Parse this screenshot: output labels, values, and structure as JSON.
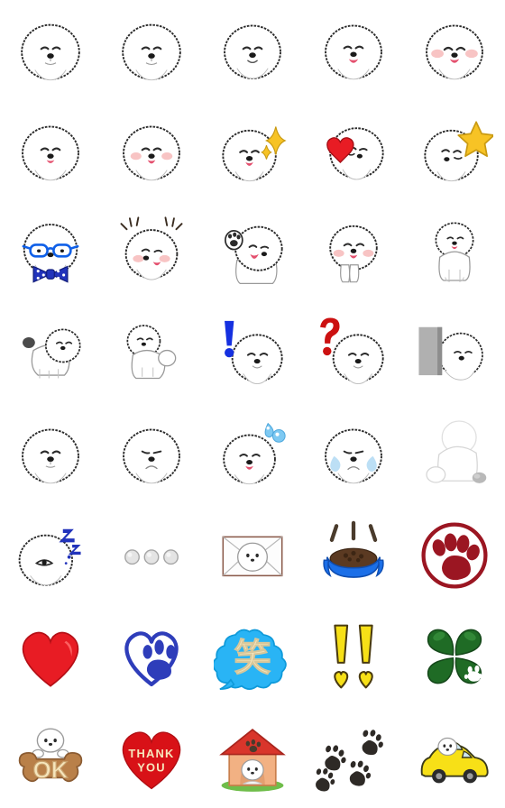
{
  "sheet": {
    "title": "Bichon Frise Emoji Sticker Set",
    "background_color": "#ffffff",
    "columns": 5,
    "rows": 8,
    "cell_size_px": 112,
    "total_stickers": 40
  },
  "palette": {
    "fur_white": "#ffffff",
    "fur_shade": "#f2f2f2",
    "outline_dark": "#2b2b2b",
    "nose_black": "#1a1a1a",
    "tongue_pink": "#e4506e",
    "blush_pink": "#f8c4c4",
    "heart_red": "#e81c24",
    "heart_red_dark": "#c4141b",
    "star_yellow": "#f7c325",
    "star_yellow_dark": "#e0a511",
    "royal_blue": "#2233bb",
    "bright_blue": "#1060e8",
    "sky_blue": "#3ab4f2",
    "cloud_blue": "#29b4f5",
    "cream": "#f6e6bd",
    "clover_green": "#1f6b25",
    "clover_green_light": "#2f8a34",
    "stamp_red": "#9b1622",
    "bone_brown": "#b98049",
    "bone_brown_light": "#caa077",
    "house_peach": "#f2b183",
    "house_roof_red": "#d9352b",
    "grass_green": "#6fbd4a",
    "car_yellow": "#f7e017",
    "tear_blue": "#bcdff5",
    "dot_gray": "#d4d4d4",
    "wall_gray": "#a8a8a8",
    "paw_black": "#2e2a26"
  },
  "stickers": [
    {
      "id": 1,
      "row": 1,
      "col": 1,
      "name": "dog-face-neutral",
      "label": "Bichon face, calm neutral expression",
      "type": "face"
    },
    {
      "id": 2,
      "row": 1,
      "col": 2,
      "name": "dog-face-neutral-2",
      "label": "Bichon face, calm neutral expression",
      "type": "face"
    },
    {
      "id": 3,
      "row": 1,
      "col": 3,
      "name": "dog-face-smiling",
      "label": "Bichon face, small smile",
      "type": "face"
    },
    {
      "id": 4,
      "row": 1,
      "col": 4,
      "name": "dog-face-tongue-out",
      "label": "Bichon face, tongue out",
      "type": "face"
    },
    {
      "id": 5,
      "row": 1,
      "col": 5,
      "name": "dog-face-blush-happy",
      "label": "Bichon face, blushing and happy",
      "type": "face"
    },
    {
      "id": 6,
      "row": 2,
      "col": 1,
      "name": "dog-face-tongue-small",
      "label": "Bichon face, little tongue",
      "type": "face"
    },
    {
      "id": 7,
      "row": 2,
      "col": 2,
      "name": "dog-face-blush-tongue",
      "label": "Bichon face, blushing with tongue",
      "type": "face"
    },
    {
      "id": 8,
      "row": 2,
      "col": 3,
      "name": "dog-face-sparkle",
      "label": "Bichon face with yellow sparkles",
      "type": "face-accessory"
    },
    {
      "id": 9,
      "row": 2,
      "col": 4,
      "name": "dog-face-red-heart",
      "label": "Bichon face with red heart",
      "type": "face-accessory"
    },
    {
      "id": 10,
      "row": 2,
      "col": 5,
      "name": "dog-face-star",
      "label": "Bichon face with yellow star",
      "type": "face-accessory"
    },
    {
      "id": 11,
      "row": 3,
      "col": 1,
      "name": "dog-glasses-bowtie",
      "label": "Bichon with blue glasses and polka-dot bow tie",
      "type": "face-accessory"
    },
    {
      "id": 12,
      "row": 3,
      "col": 2,
      "name": "dog-face-excited",
      "label": "Bichon face, excited with motion lines",
      "type": "face"
    },
    {
      "id": 13,
      "row": 3,
      "col": 3,
      "name": "dog-waving-paw",
      "label": "Bichon waving a paw, tongue out",
      "type": "body"
    },
    {
      "id": 14,
      "row": 3,
      "col": 4,
      "name": "dog-standing-happy",
      "label": "Bichon standing, blushing and happy",
      "type": "body"
    },
    {
      "id": 15,
      "row": 3,
      "col": 5,
      "name": "dog-sitting-front",
      "label": "Bichon sitting, facing front",
      "type": "body"
    },
    {
      "id": 16,
      "row": 4,
      "col": 1,
      "name": "dog-walking",
      "label": "Bichon walking, tail up",
      "type": "body"
    },
    {
      "id": 17,
      "row": 4,
      "col": 2,
      "name": "dog-sitting-side",
      "label": "Bichon sitting, side view",
      "type": "body"
    },
    {
      "id": 18,
      "row": 4,
      "col": 3,
      "name": "dog-exclamation-blue",
      "label": "Bichon with blue exclamation mark",
      "type": "face-accessory"
    },
    {
      "id": 19,
      "row": 4,
      "col": 4,
      "name": "dog-question-red",
      "label": "Bichon with red question mark",
      "type": "face-accessory"
    },
    {
      "id": 20,
      "row": 4,
      "col": 5,
      "name": "dog-peeking-wall",
      "label": "Bichon peeking from behind a gray wall",
      "type": "scene"
    },
    {
      "id": 21,
      "row": 5,
      "col": 1,
      "name": "dog-face-plain",
      "label": "Bichon face, plain expression",
      "type": "face"
    },
    {
      "id": 22,
      "row": 5,
      "col": 2,
      "name": "dog-face-sad",
      "label": "Bichon face, sad frown",
      "type": "face"
    },
    {
      "id": 23,
      "row": 5,
      "col": 3,
      "name": "dog-face-sweatdrop",
      "label": "Bichon face with blue sweat drops",
      "type": "face-accessory"
    },
    {
      "id": 24,
      "row": 5,
      "col": 4,
      "name": "dog-face-crying",
      "label": "Bichon face crying with tears",
      "type": "face"
    },
    {
      "id": 25,
      "row": 5,
      "col": 5,
      "name": "dog-back-sulking",
      "label": "Bichon seen from behind, sulking",
      "type": "body"
    },
    {
      "id": 26,
      "row": 6,
      "col": 1,
      "name": "dog-sleeping-zzz",
      "label": "Bichon sleeping with blue Z Z Z",
      "type": "face-accessory"
    },
    {
      "id": 27,
      "row": 6,
      "col": 2,
      "name": "loading-dots",
      "label": "Three gray loading dots",
      "type": "object"
    },
    {
      "id": 28,
      "row": 6,
      "col": 3,
      "name": "envelope-dog",
      "label": "White envelope with dog face",
      "type": "object"
    },
    {
      "id": 29,
      "row": 6,
      "col": 4,
      "name": "food-bowl",
      "label": "Blue dog food bowl with kibble",
      "type": "object"
    },
    {
      "id": 30,
      "row": 6,
      "col": 5,
      "name": "paw-stamp-red",
      "label": "Dark red paw print stamp in a circle",
      "type": "object"
    },
    {
      "id": 31,
      "row": 7,
      "col": 1,
      "name": "heart-red",
      "label": "Red heart",
      "type": "object"
    },
    {
      "id": 32,
      "row": 7,
      "col": 2,
      "name": "heart-paw-blue",
      "label": "Blue heart outline with paw print",
      "type": "object"
    },
    {
      "id": 33,
      "row": 7,
      "col": 3,
      "name": "speech-bubble-warai",
      "label": "Blue cloud speech bubble",
      "text": "笑",
      "type": "text-object"
    },
    {
      "id": 34,
      "row": 7,
      "col": 4,
      "name": "double-exclamation-yellow",
      "label": "Two yellow exclamation marks with heart dots",
      "text": "!!",
      "type": "text-object"
    },
    {
      "id": 35,
      "row": 7,
      "col": 5,
      "name": "four-leaf-clover",
      "label": "Green four-leaf clover with white paw",
      "type": "object"
    },
    {
      "id": 36,
      "row": 8,
      "col": 1,
      "name": "ok-bone",
      "label": "Brown bone with dog peeking over",
      "text": "OK",
      "type": "text-object"
    },
    {
      "id": 37,
      "row": 8,
      "col": 2,
      "name": "thank-you-heart",
      "label": "Red heart with thank you message",
      "text": "THANK YOU",
      "text_line1": "THANK",
      "text_line2": "YOU",
      "type": "text-object"
    },
    {
      "id": 38,
      "row": 8,
      "col": 3,
      "name": "dog-house",
      "label": "Dog house with red roof and Bichon inside",
      "type": "scene"
    },
    {
      "id": 39,
      "row": 8,
      "col": 4,
      "name": "paw-prints-trail",
      "label": "Four black paw prints in a trail",
      "type": "object"
    },
    {
      "id": 40,
      "row": 8,
      "col": 5,
      "name": "yellow-car-dog",
      "label": "Yellow car with Bichon driving",
      "type": "scene"
    }
  ]
}
